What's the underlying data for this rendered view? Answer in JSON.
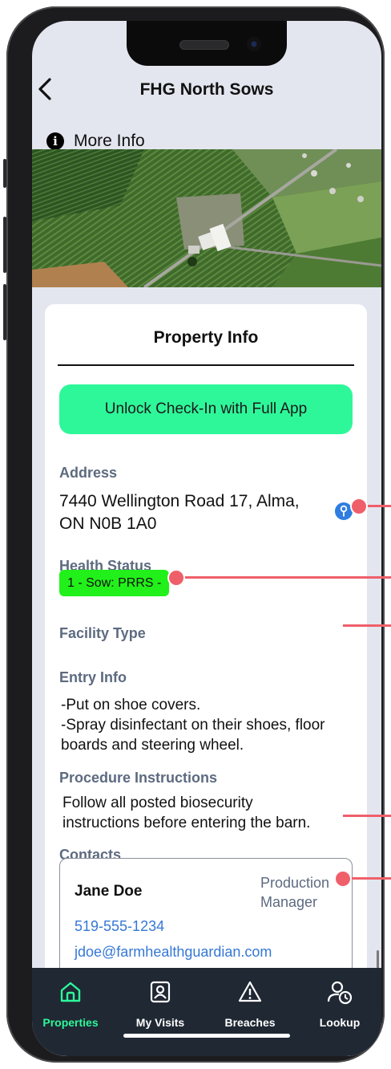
{
  "header": {
    "title": "FHG North Sows",
    "more_info_label": "More Info"
  },
  "property_card": {
    "title": "Property Info",
    "unlock_button": "Unlock Check-In with Full App",
    "address_label": "Address",
    "address_line1": "7440 Wellington Road 17, Alma,",
    "address_line2": "ON N0B 1A0",
    "health_status_label": "Health Status",
    "health_status_badge": "1 - Sow: PRRS -",
    "facility_type_label": "Facility Type",
    "entry_info_label": "Entry Info",
    "entry_info_line1": "-Put on shoe covers.",
    "entry_info_line2": "-Spray disinfectant on their shoes, floor",
    "entry_info_line3": "boards and steering wheel.",
    "procedure_label": "Procedure Instructions",
    "procedure_line1": "Follow all posted biosecurity",
    "procedure_line2": "instructions before entering the barn.",
    "contacts_label": "Contacts"
  },
  "contact": {
    "name": "Jane Doe",
    "role_line1": "Production",
    "role_line2": "Manager",
    "phone": "519-555-1234",
    "email": "jdoe@farmhealthguardian.com"
  },
  "tabs": [
    {
      "label": "Properties",
      "icon": "home-icon",
      "active": true
    },
    {
      "label": "My Visits",
      "icon": "visitor-badge-icon",
      "active": false
    },
    {
      "label": "Breaches",
      "icon": "warning-icon",
      "active": false
    },
    {
      "label": "Lookup",
      "icon": "user-clock-icon",
      "active": false
    }
  ],
  "colors": {
    "accent": "#2ef79a",
    "badge": "#22f01a",
    "link": "#3578d6",
    "tabbar": "#1f2833",
    "callout": "#ef5f6a",
    "screen_bg": "#e3e6ef"
  }
}
